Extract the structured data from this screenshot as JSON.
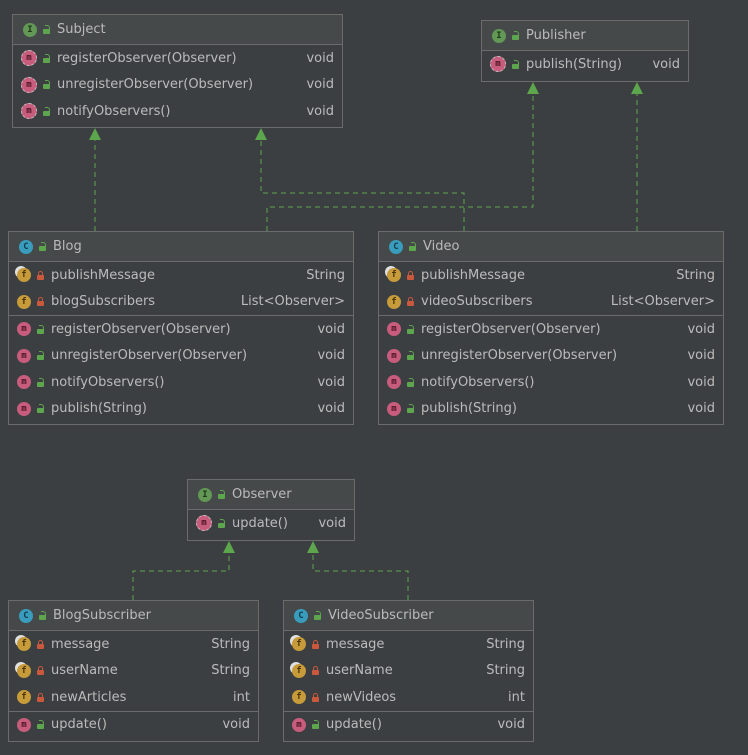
{
  "colors": {
    "background": "#3c3f41",
    "header": "#45494a",
    "border": "#6b6b6b",
    "link": "#5ea64e",
    "text": "#bbbbbb"
  },
  "diagram": {
    "subject": {
      "name": "Subject",
      "kind": "interface",
      "methods": [
        {
          "name": "registerObserver(Observer)",
          "type": "void"
        },
        {
          "name": "unregisterObserver(Observer)",
          "type": "void"
        },
        {
          "name": "notifyObservers()",
          "type": "void"
        }
      ]
    },
    "publisher": {
      "name": "Publisher",
      "kind": "interface",
      "methods": [
        {
          "name": "publish(String)",
          "type": "void"
        }
      ]
    },
    "blog": {
      "name": "Blog",
      "kind": "class",
      "fields": [
        {
          "name": "publishMessage",
          "type": "String"
        },
        {
          "name": "blogSubscribers",
          "type": "List<Observer>"
        }
      ],
      "methods": [
        {
          "name": "registerObserver(Observer)",
          "type": "void"
        },
        {
          "name": "unregisterObserver(Observer)",
          "type": "void"
        },
        {
          "name": "notifyObservers()",
          "type": "void"
        },
        {
          "name": "publish(String)",
          "type": "void"
        }
      ]
    },
    "video": {
      "name": "Video",
      "kind": "class",
      "fields": [
        {
          "name": "publishMessage",
          "type": "String"
        },
        {
          "name": "videoSubscribers",
          "type": "List<Observer>"
        }
      ],
      "methods": [
        {
          "name": "registerObserver(Observer)",
          "type": "void"
        },
        {
          "name": "unregisterObserver(Observer)",
          "type": "void"
        },
        {
          "name": "notifyObservers()",
          "type": "void"
        },
        {
          "name": "publish(String)",
          "type": "void"
        }
      ]
    },
    "observer": {
      "name": "Observer",
      "kind": "interface",
      "methods": [
        {
          "name": "update()",
          "type": "void"
        }
      ]
    },
    "blog_subscriber": {
      "name": "BlogSubscriber",
      "kind": "class",
      "fields": [
        {
          "name": "message",
          "type": "String"
        },
        {
          "name": "userName",
          "type": "String"
        },
        {
          "name": "newArticles",
          "type": "int"
        }
      ],
      "methods": [
        {
          "name": "update()",
          "type": "void"
        }
      ]
    },
    "video_subscriber": {
      "name": "VideoSubscriber",
      "kind": "class",
      "fields": [
        {
          "name": "message",
          "type": "String"
        },
        {
          "name": "userName",
          "type": "String"
        },
        {
          "name": "newVideos",
          "type": "int"
        }
      ],
      "methods": [
        {
          "name": "update()",
          "type": "void"
        }
      ]
    },
    "icons": {
      "interface": "I",
      "class": "C",
      "method": "m",
      "field": "f"
    }
  }
}
